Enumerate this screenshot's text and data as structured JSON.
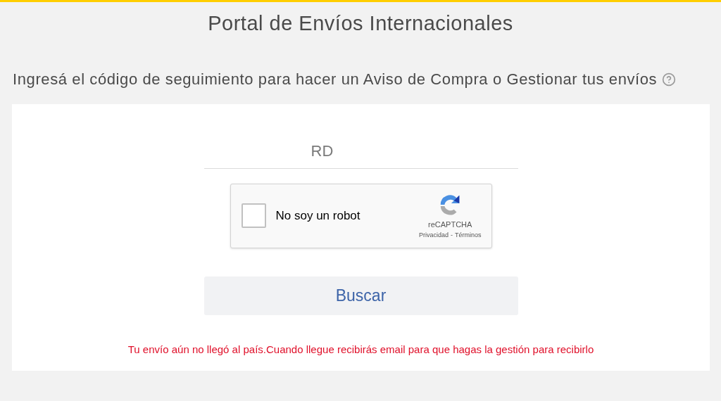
{
  "page": {
    "title": "Portal de Envíos Internacionales"
  },
  "instruction": "Ingresá el código de seguimiento para hacer un Aviso de Compra o Gestionar tus envíos",
  "tracking_field": {
    "placeholder": "RD"
  },
  "captcha": {
    "label": "No soy un robot",
    "checked": false,
    "brand": "reCAPTCHA",
    "privacy": "Privacidad",
    "separator": "-",
    "terms": "Términos"
  },
  "search_button": "Buscar",
  "message": "Tu envío aún no llegó al país.Cuando llegue recibirás email para que hagas la gestión para recibirlo"
}
